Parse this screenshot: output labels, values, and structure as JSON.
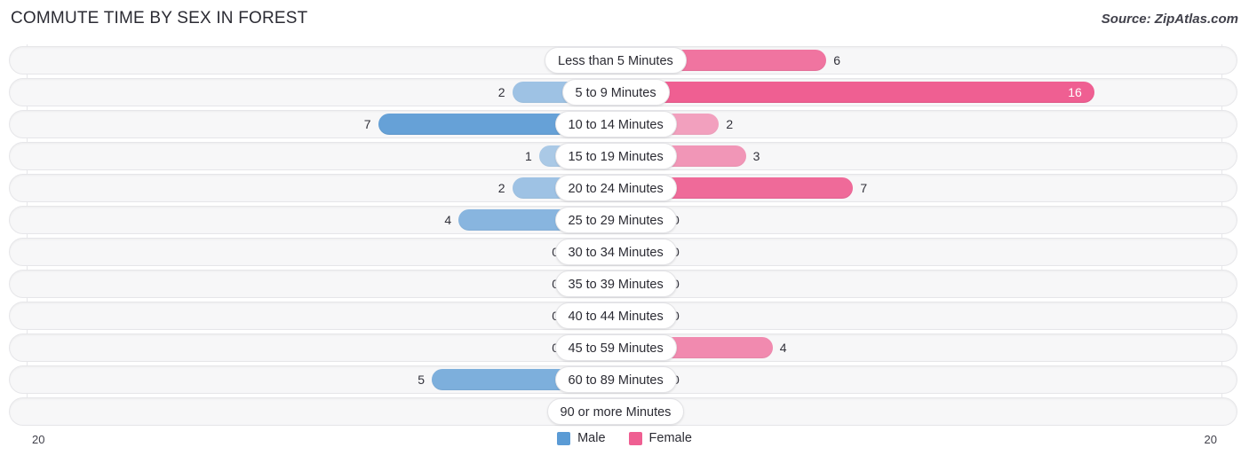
{
  "header": {
    "title": "COMMUTE TIME BY SEX IN FOREST",
    "source": "Source: ZipAtlas.com"
  },
  "legend": {
    "male_label": "Male",
    "female_label": "Female",
    "male_color": "#5b9bd5",
    "female_color": "#ef5f92"
  },
  "axis": {
    "left_label": "20",
    "right_label": "20",
    "max": 20
  },
  "chart_data": {
    "type": "bar",
    "subtype": "diverging-bar",
    "title": "COMMUTE TIME BY SEX IN FOREST",
    "xlabel": "",
    "ylabel": "",
    "xlim": [
      20,
      20
    ],
    "grid": true,
    "legend_position": "bottom-center",
    "categories": [
      "Less than 5 Minutes",
      "5 to 9 Minutes",
      "10 to 14 Minutes",
      "15 to 19 Minutes",
      "20 to 24 Minutes",
      "25 to 29 Minutes",
      "30 to 34 Minutes",
      "35 to 39 Minutes",
      "40 to 44 Minutes",
      "45 to 59 Minutes",
      "60 to 89 Minutes",
      "90 or more Minutes"
    ],
    "series": [
      {
        "name": "Male",
        "values": [
          0,
          2,
          7,
          1,
          2,
          4,
          0,
          0,
          0,
          0,
          5,
          0
        ]
      },
      {
        "name": "Female",
        "values": [
          6,
          16,
          2,
          3,
          7,
          0,
          0,
          0,
          0,
          4,
          0,
          0
        ]
      }
    ]
  },
  "rows": [
    {
      "label": "Less than 5 Minutes",
      "male": "0",
      "female": "6"
    },
    {
      "label": "5 to 9 Minutes",
      "male": "2",
      "female": "16"
    },
    {
      "label": "10 to 14 Minutes",
      "male": "7",
      "female": "2"
    },
    {
      "label": "15 to 19 Minutes",
      "male": "1",
      "female": "3"
    },
    {
      "label": "20 to 24 Minutes",
      "male": "2",
      "female": "7"
    },
    {
      "label": "25 to 29 Minutes",
      "male": "4",
      "female": "0"
    },
    {
      "label": "30 to 34 Minutes",
      "male": "0",
      "female": "0"
    },
    {
      "label": "35 to 39 Minutes",
      "male": "0",
      "female": "0"
    },
    {
      "label": "40 to 44 Minutes",
      "male": "0",
      "female": "0"
    },
    {
      "label": "45 to 59 Minutes",
      "male": "0",
      "female": "4"
    },
    {
      "label": "60 to 89 Minutes",
      "male": "5",
      "female": "0"
    },
    {
      "label": "90 or more Minutes",
      "male": "0",
      "female": "0"
    }
  ]
}
